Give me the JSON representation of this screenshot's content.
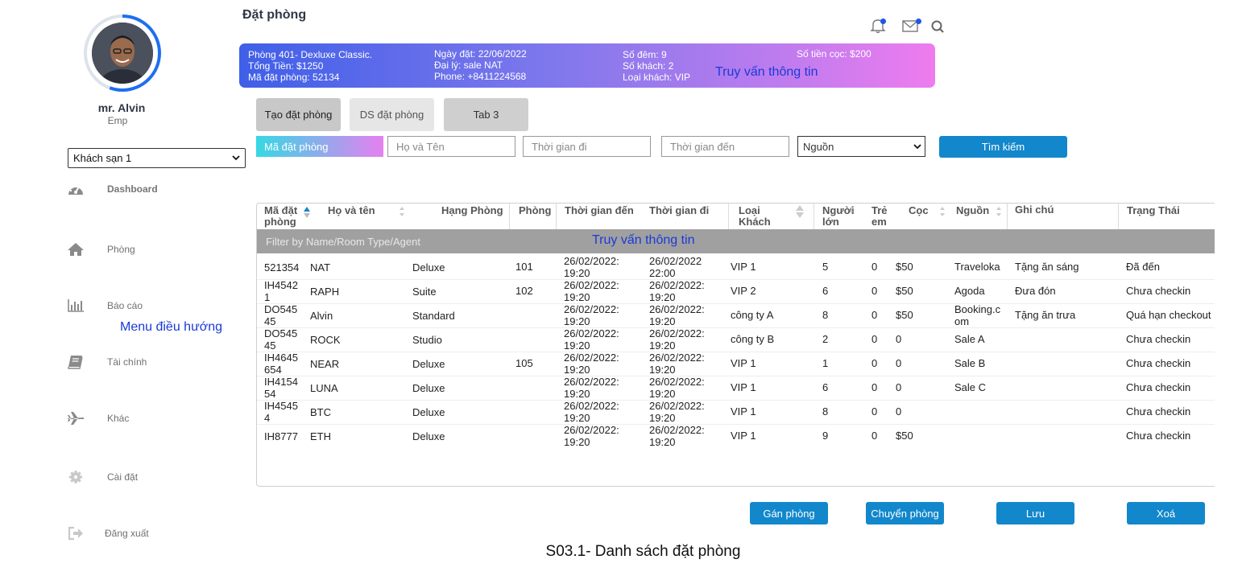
{
  "header": {
    "title": "Đặt phòng"
  },
  "user": {
    "name": "mr. Alvin",
    "role": "Emp"
  },
  "hotel_select": {
    "value": "Khách sạn 1"
  },
  "nav": {
    "items": [
      {
        "label": "Dashboard",
        "icon": "dashboard-icon"
      },
      {
        "label": "Phòng",
        "icon": "home-icon"
      },
      {
        "label": "Báo cáo",
        "icon": "bar-chart-icon"
      },
      {
        "label": "Tài chính",
        "icon": "book-icon"
      },
      {
        "label": "Khác",
        "icon": "plane-icon"
      },
      {
        "label": "Cài đặt",
        "icon": "gear-icon"
      },
      {
        "label": "Đăng xuất",
        "icon": "logout-icon"
      }
    ],
    "annotation": "Menu điều hướng"
  },
  "banner": {
    "room": "Phòng 401- Dexluxe Classic.",
    "total": "Tổng Tiền: $1250",
    "booking_code": "Mã đặt phòng: 52134",
    "date": "Ngày đặt: 22/06/2022",
    "agent": "Đại lý: sale NAT",
    "phone": "Phone: +8411224568",
    "nights": "Số đêm: 9",
    "guests": "Số khách: 2",
    "guest_type": "Loại khách: VIP",
    "deposit": "Số tiền cọc: $200",
    "annotation": "Truy vấn thông tin"
  },
  "tabs": [
    {
      "label": "Tạo đặt phòng"
    },
    {
      "label": "DS đặt phòng"
    },
    {
      "label": "Tab 3"
    }
  ],
  "search": {
    "code_placeholder": "Mã đặt phòng",
    "name_placeholder": "Họ và Tên",
    "depart_placeholder": "Thời gian đi",
    "arrive_placeholder": "Thời gian đến",
    "source_value": "Nguồn",
    "button_label": "Tìm kiếm"
  },
  "table": {
    "headers": {
      "code": "Mã đặt phòng",
      "name": "Họ và tên",
      "room_type": "Hạng Phòng",
      "room": "Phòng",
      "arrive": "Thời gian đến",
      "depart": "Thời gian đi",
      "guest_type": "Loại Khách",
      "adults": "Người lớn",
      "children": "Trẻ em",
      "deposit": "Cọc",
      "source": "Nguồn",
      "note": "Ghi chú",
      "status": "Trạng Thái"
    },
    "filter_placeholder": "Filter by Name/Room Type/Agent",
    "filter_annotation": "Truy vấn thông tin",
    "rows": [
      {
        "code": [
          "521354",
          ""
        ],
        "name": "NAT",
        "room_type": "Deluxe",
        "room": "101",
        "arrive": [
          "26/02/2022:",
          "19:20"
        ],
        "depart": [
          "26/02/2022",
          "22:00"
        ],
        "guest_type": "VIP 1",
        "adults": "5",
        "children": "0",
        "deposit": "$50",
        "source": [
          "Traveloka",
          ""
        ],
        "note": "Tặng ăn sáng",
        "status": "Đã đến"
      },
      {
        "code": [
          "IH4542",
          "1"
        ],
        "name": "RAPH",
        "room_type": "Suite",
        "room": "102",
        "arrive": [
          "26/02/2022:",
          "19:20"
        ],
        "depart": [
          "26/02/2022:",
          "19:20"
        ],
        "guest_type": "VIP 2",
        "adults": "6",
        "children": "0",
        "deposit": "$50",
        "source": [
          "Agoda",
          ""
        ],
        "note": "Đưa đón",
        "status": "Chưa checkin"
      },
      {
        "code": [
          "DO545",
          "45"
        ],
        "name": "Alvin",
        "room_type": "Standard",
        "room": "",
        "arrive": [
          "26/02/2022:",
          "19:20"
        ],
        "depart": [
          "26/02/2022:",
          "19:20"
        ],
        "guest_type": "công ty A",
        "adults": "8",
        "children": "0",
        "deposit": "$50",
        "source": [
          "Booking.c",
          "om"
        ],
        "note": "Tặng ăn trưa",
        "status": "Quá hạn checkout"
      },
      {
        "code": [
          "DO545",
          "45"
        ],
        "name": "ROCK",
        "room_type": "Studio",
        "room": "",
        "arrive": [
          "26/02/2022:",
          "19:20"
        ],
        "depart": [
          "26/02/2022:",
          "19:20"
        ],
        "guest_type": "công ty B",
        "adults": "2",
        "children": "0",
        "deposit": "0",
        "source": [
          "Sale A",
          ""
        ],
        "note": "",
        "status": "Chưa checkin"
      },
      {
        "code": [
          "IH4645",
          "654"
        ],
        "name": "NEAR",
        "room_type": "Deluxe",
        "room": "105",
        "arrive": [
          "26/02/2022:",
          "19:20"
        ],
        "depart": [
          "26/02/2022:",
          "19:20"
        ],
        "guest_type": "VIP 1",
        "adults": "1",
        "children": "0",
        "deposit": "0",
        "source": [
          "Sale B",
          ""
        ],
        "note": "",
        "status": "Chưa checkin"
      },
      {
        "code": [
          "IH4154",
          "54"
        ],
        "name": "LUNA",
        "room_type": "Deluxe",
        "room": "",
        "arrive": [
          "26/02/2022:",
          "19:20"
        ],
        "depart": [
          "26/02/2022:",
          "19:20"
        ],
        "guest_type": "VIP 1",
        "adults": "6",
        "children": "0",
        "deposit": "0",
        "source": [
          "Sale C",
          ""
        ],
        "note": "",
        "status": "Chưa checkin"
      },
      {
        "code": [
          "IH4545",
          "4"
        ],
        "name": "BTC",
        "room_type": "Deluxe",
        "room": "",
        "arrive": [
          "26/02/2022:",
          "19:20"
        ],
        "depart": [
          "26/02/2022:",
          "19:20"
        ],
        "guest_type": "VIP 1",
        "adults": "8",
        "children": "0",
        "deposit": "0",
        "source": [
          "",
          ""
        ],
        "note": "",
        "status": "Chưa checkin"
      },
      {
        "code": [
          "IH8777",
          ""
        ],
        "name": "ETH",
        "room_type": "Deluxe",
        "room": "",
        "arrive": [
          "26/02/2022:",
          "19:20"
        ],
        "depart": [
          "26/02/2022:",
          "19:20"
        ],
        "guest_type": "VIP 1",
        "adults": "9",
        "children": "0",
        "deposit": "$50",
        "source": [
          "",
          ""
        ],
        "note": "",
        "status": "Chưa checkin"
      }
    ]
  },
  "actions": {
    "assign": "Gán phòng",
    "move": "Chuyển phòng",
    "save": "Lưu",
    "delete": "Xoá"
  },
  "caption": "S03.1- Danh sách đặt phòng",
  "colors": {
    "accent": "#1287cb",
    "annotation": "#1a3ad8",
    "tab_active": "#c8c8c8",
    "tab_inactive": "#e6e6e6"
  }
}
